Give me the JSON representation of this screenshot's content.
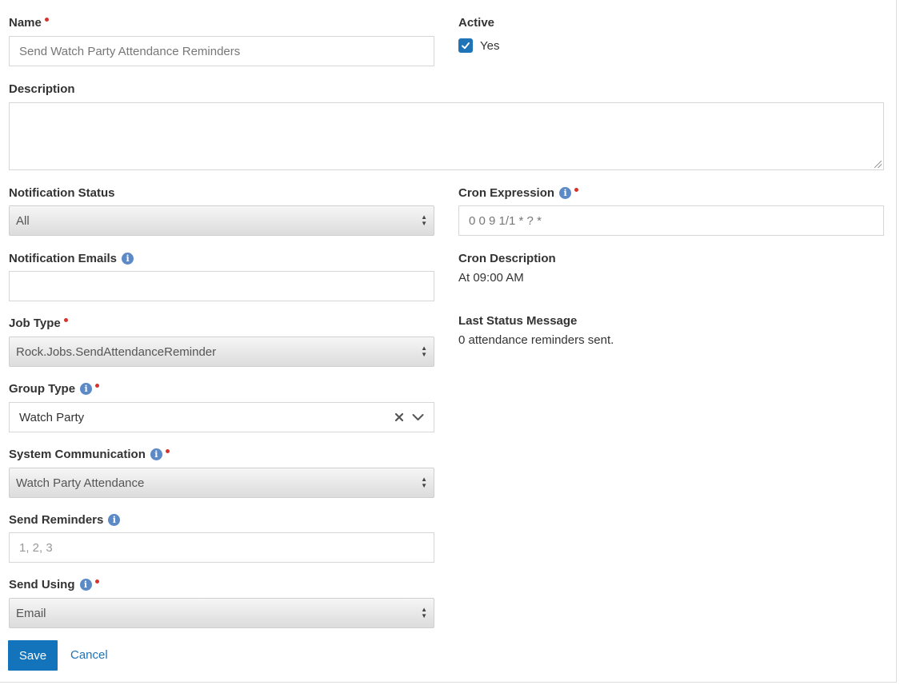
{
  "form": {
    "name_label": "Name",
    "name_value": "Send Watch Party Attendance Reminders",
    "active_label": "Active",
    "active_option": "Yes",
    "active_checked": true,
    "description_label": "Description",
    "description_value": "",
    "notification_status_label": "Notification Status",
    "notification_status_value": "All",
    "cron_expression_label": "Cron Expression",
    "cron_expression_value": "0 0 9 1/1 * ? *",
    "notification_emails_label": "Notification Emails",
    "notification_emails_value": "",
    "cron_description_label": "Cron Description",
    "cron_description_value": "At 09:00 AM",
    "job_type_label": "Job Type",
    "job_type_value": "Rock.Jobs.SendAttendanceReminder",
    "last_status_label": "Last Status Message",
    "last_status_value": "0 attendance reminders sent.",
    "group_type_label": "Group Type",
    "group_type_value": "Watch Party",
    "system_communication_label": "System Communication",
    "system_communication_value": "Watch Party Attendance",
    "send_reminders_label": "Send Reminders",
    "send_reminders_placeholder": "1, 2, 3",
    "send_using_label": "Send Using",
    "send_using_value": "Email"
  },
  "actions": {
    "save_label": "Save",
    "cancel_label": "Cancel"
  },
  "icons": {
    "info": "info-circle-icon",
    "required": "required-dot-icon",
    "check": "check-icon",
    "clear": "clear-x-icon",
    "chevron": "chevron-down-icon",
    "select_arrows": "select-arrows-icon"
  },
  "colors": {
    "accent": "#1f73b7",
    "required": "#d4342e",
    "info": "#5c8ac7"
  }
}
